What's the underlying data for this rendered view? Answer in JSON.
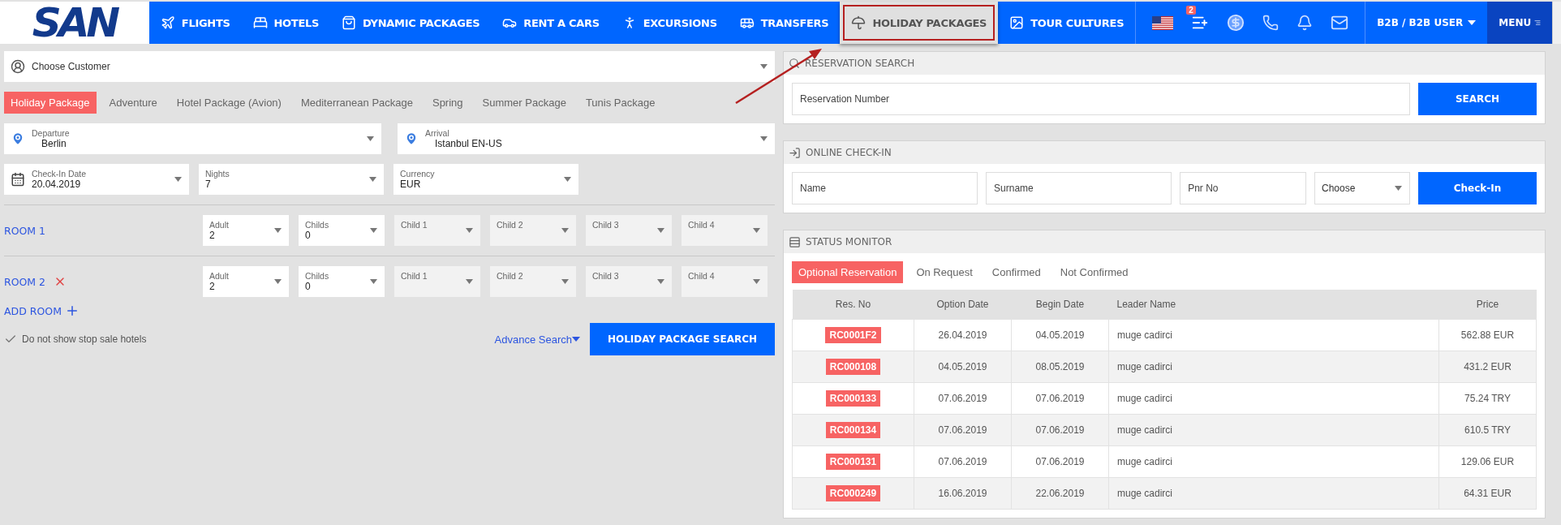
{
  "nav": {
    "logo": "SAN",
    "items": [
      {
        "label": "FLIGHTS",
        "kind": "plane",
        "selected": false
      },
      {
        "label": "HOTELS",
        "kind": "bed",
        "selected": false
      },
      {
        "label": "DYNAMIC PACKAGES",
        "kind": "bag",
        "selected": false
      },
      {
        "label": "RENT A CARS",
        "kind": "car",
        "selected": false
      },
      {
        "label": "EXCURSIONS",
        "kind": "walker",
        "selected": false
      },
      {
        "label": "TRANSFERS",
        "kind": "bus",
        "selected": false
      },
      {
        "label": "HOLIDAY PACKAGES",
        "kind": "umbrella",
        "selected": true
      },
      {
        "label": "TOUR CULTURES",
        "kind": "picture",
        "selected": false
      }
    ],
    "cart_badge": "2",
    "user": "B2B / B2B USER",
    "menu": "MENU"
  },
  "customer": {
    "placeholder": "Choose Customer"
  },
  "package_tabs": [
    {
      "label": "Holiday Package",
      "selected": true
    },
    {
      "label": "Adventure",
      "selected": false
    },
    {
      "label": "Hotel Package (Avion)",
      "selected": false
    },
    {
      "label": "Mediterranean Package",
      "selected": false
    },
    {
      "label": "Spring",
      "selected": false
    },
    {
      "label": "Summer Package",
      "selected": false
    },
    {
      "label": "Tunis Package",
      "selected": false
    }
  ],
  "departure": {
    "label": "Departure",
    "value": "Berlin"
  },
  "arrival": {
    "label": "Arrival",
    "value": "Istanbul EN-US"
  },
  "check_in": {
    "label": "Check-In Date",
    "value": "20.04.2019"
  },
  "nights": {
    "label": "Nights",
    "value": "7"
  },
  "currency": {
    "label": "Currency",
    "value": "EUR"
  },
  "rooms": [
    {
      "label": "ROOM 1",
      "removable": false,
      "fields": [
        {
          "label": "Adult",
          "value": "2",
          "disabled": false
        },
        {
          "label": "Childs",
          "value": "0",
          "disabled": false
        },
        {
          "label": "Child 1",
          "disabled": true
        },
        {
          "label": "Child 2",
          "disabled": true
        },
        {
          "label": "Child 3",
          "disabled": true
        },
        {
          "label": "Child 4",
          "disabled": true
        }
      ]
    },
    {
      "label": "ROOM 2",
      "removable": true,
      "fields": [
        {
          "label": "Adult",
          "value": "2",
          "disabled": false
        },
        {
          "label": "Childs",
          "value": "0",
          "disabled": false
        },
        {
          "label": "Child 1",
          "disabled": true
        },
        {
          "label": "Child 2",
          "disabled": true
        },
        {
          "label": "Child 3",
          "disabled": true
        },
        {
          "label": "Child 4",
          "disabled": true
        }
      ]
    }
  ],
  "add_room": "ADD ROOM",
  "stop_sale": {
    "label": "Do not show stop sale hotels",
    "checked": true
  },
  "advance_search": "Advance Search",
  "search_button": "HOLIDAY PACKAGE SEARCH",
  "reservation_search": {
    "title": "RESERVATION SEARCH",
    "placeholder": "Reservation Number",
    "button": "SEARCH"
  },
  "online_checkin": {
    "title": "ONLINE CHECK-IN",
    "placeholders": [
      "Name",
      "Surname",
      "Pnr No"
    ],
    "select": "Choose",
    "button": "Check-In"
  },
  "status_monitor": {
    "title": "STATUS MONITOR",
    "tabs": [
      {
        "label": "Optional Reservation",
        "selected": true
      },
      {
        "label": "On Request",
        "selected": false
      },
      {
        "label": "Confirmed",
        "selected": false
      },
      {
        "label": "Not Confirmed",
        "selected": false
      }
    ],
    "columns": [
      "Res. No",
      "Option Date",
      "Begin Date",
      "Leader Name",
      "Price"
    ],
    "rows": [
      [
        "RC0001F2",
        "26.04.2019",
        "04.05.2019",
        "muge cadirci",
        "562.88 EUR"
      ],
      [
        "RC000108",
        "04.05.2019",
        "08.05.2019",
        "muge cadirci",
        "431.2 EUR"
      ],
      [
        "RC000133",
        "07.06.2019",
        "07.06.2019",
        "muge cadirci",
        "75.24 TRY"
      ],
      [
        "RC000134",
        "07.06.2019",
        "07.06.2019",
        "muge cadirci",
        "610.5 TRY"
      ],
      [
        "RC000131",
        "07.06.2019",
        "07.06.2019",
        "muge cadirci",
        "129.06 EUR"
      ],
      [
        "RC000249",
        "16.06.2019",
        "22.06.2019",
        "muge cadirci",
        "64.31 EUR"
      ]
    ]
  }
}
